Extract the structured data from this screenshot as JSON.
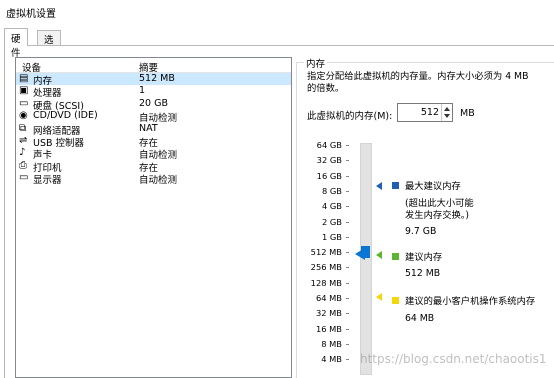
{
  "window": {
    "title": "虚拟机设置"
  },
  "tabs": [
    {
      "label": "硬件",
      "active": true
    },
    {
      "label": "选项",
      "active": false
    }
  ],
  "device_list": {
    "headers": {
      "device": "设备",
      "summary": "摘要"
    },
    "rows": [
      {
        "name": "内存",
        "summary": "512 MB",
        "icon": "memory-icon",
        "selected": true
      },
      {
        "name": "处理器",
        "summary": "1",
        "icon": "processor-icon",
        "selected": false
      },
      {
        "name": "硬盘 (SCSI)",
        "summary": "20 GB",
        "icon": "harddisk-icon",
        "selected": false
      },
      {
        "name": "CD/DVD (IDE)",
        "summary": "自动检测",
        "icon": "cd-dvd-icon",
        "selected": false
      },
      {
        "name": "网络适配器",
        "summary": "NAT",
        "icon": "network-adapter-icon",
        "selected": false
      },
      {
        "name": "USB 控制器",
        "summary": "存在",
        "icon": "usb-icon",
        "selected": false
      },
      {
        "name": "声卡",
        "summary": "自动检测",
        "icon": "sound-card-icon",
        "selected": false
      },
      {
        "name": "打印机",
        "summary": "存在",
        "icon": "printer-icon",
        "selected": false
      },
      {
        "name": "显示器",
        "summary": "自动检测",
        "icon": "display-icon",
        "selected": false
      }
    ]
  },
  "memory_panel": {
    "title": "内存",
    "description_line1": "指定分配给此虚拟机的内存量。内存大小必须为 4 MB",
    "description_line2": "的倍数。",
    "field_label": "此虚拟机的内存(M):",
    "field_value": "512",
    "unit": "MB",
    "scale_labels": [
      "64 GB",
      "32 GB",
      "16 GB",
      "8 GB",
      "4 GB",
      "2 GB",
      "1 GB",
      "512 MB",
      "256 MB",
      "128 MB",
      "64 MB",
      "32 MB",
      "16 MB",
      "8 MB",
      "4 MB"
    ],
    "slider_value_mb": 512,
    "legend": [
      {
        "label": "最大建议内存",
        "note_line1": "(超出此大小可能",
        "note_line2": "发生内存交换。)",
        "value": "9.7 GB",
        "color": "#1f5fb4"
      },
      {
        "label": "建议内存",
        "value": "512 MB",
        "color": "#5cb531"
      },
      {
        "label": "建议的最小客户机操作系统内存",
        "value": "64 MB",
        "color": "#f5d60a"
      }
    ]
  },
  "watermark": "https://blog.csdn.net/chaootis1"
}
